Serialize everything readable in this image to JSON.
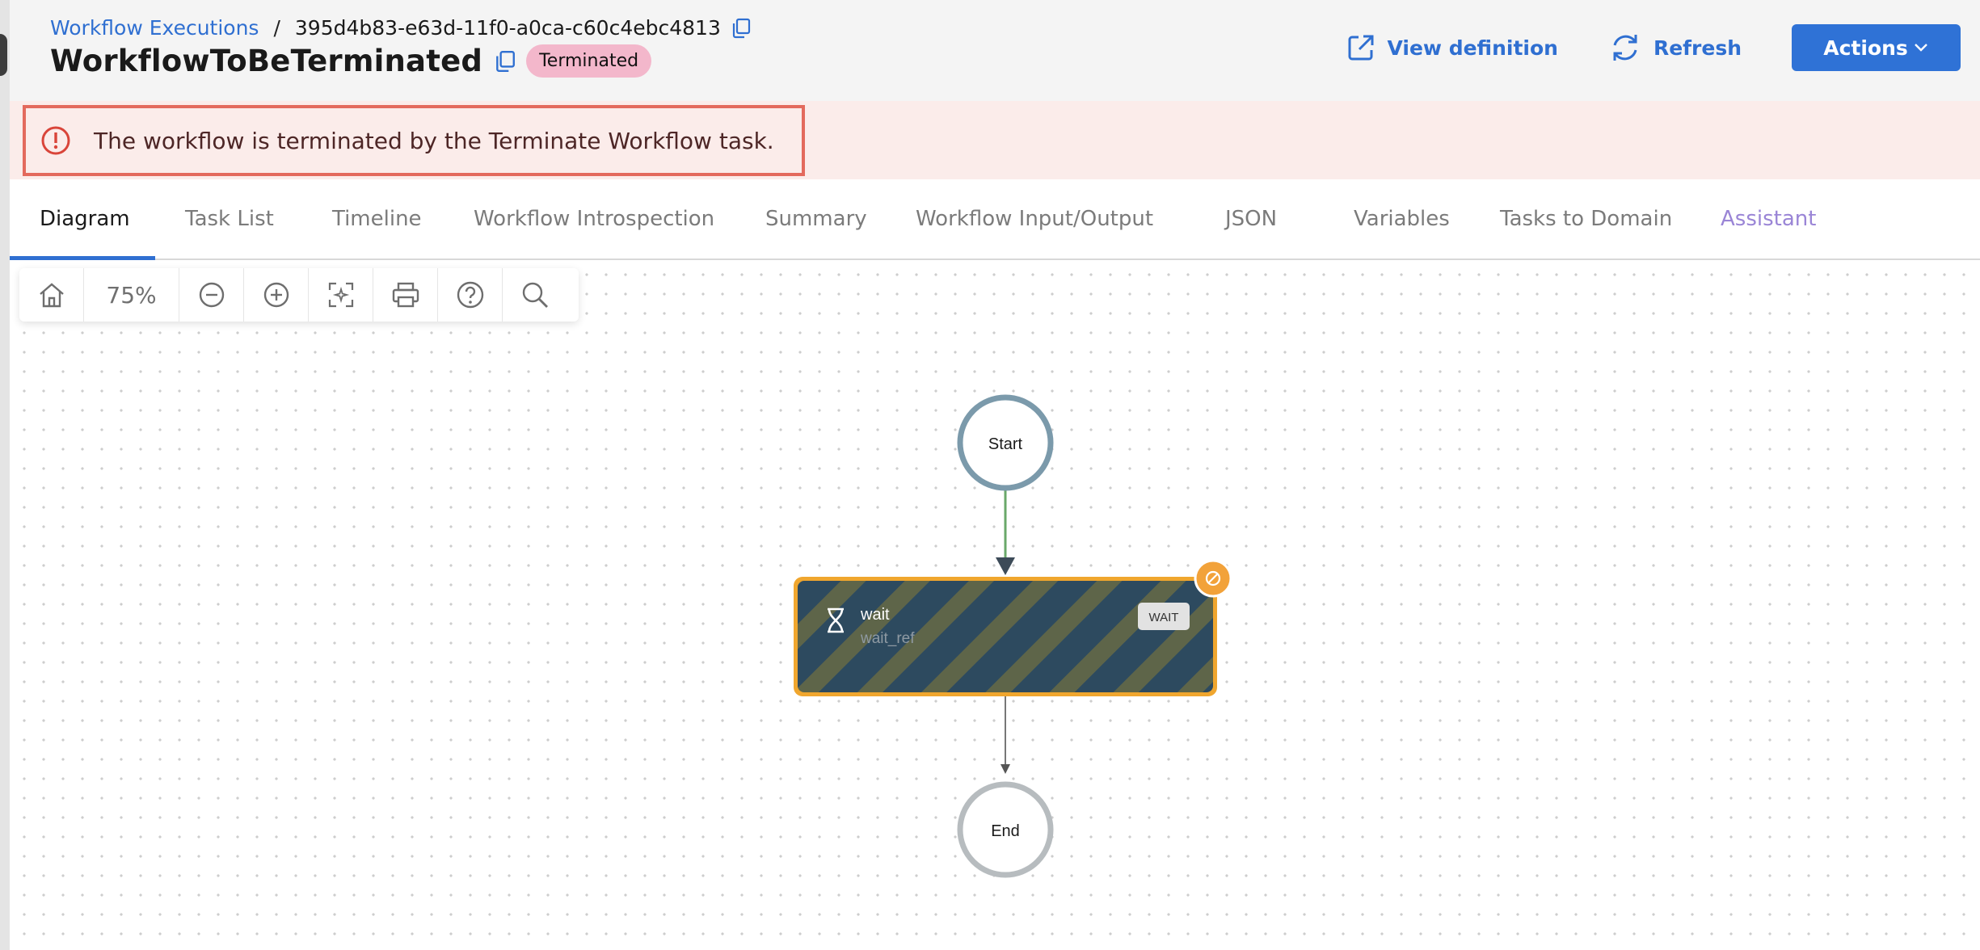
{
  "breadcrumb": {
    "parent": "Workflow Executions",
    "separator": "/",
    "execution_id": "395d4b83-e63d-11f0-a0ca-c60c4ebc4813"
  },
  "workflow": {
    "name": "WorkflowToBeTerminated",
    "status": "Terminated"
  },
  "header_actions": {
    "view_definition": "View definition",
    "refresh": "Refresh",
    "actions": "Actions"
  },
  "alert": {
    "message": "The workflow is terminated by the Terminate Workflow task."
  },
  "tabs": [
    {
      "label": "Diagram"
    },
    {
      "label": "Task List"
    },
    {
      "label": "Timeline"
    },
    {
      "label": "Workflow Introspection"
    },
    {
      "label": "Summary"
    },
    {
      "label": "Workflow Input/Output"
    },
    {
      "label": "JSON"
    },
    {
      "label": "Variables"
    },
    {
      "label": "Tasks to Domain"
    },
    {
      "label": "Assistant"
    }
  ],
  "toolbar": {
    "zoom_level": "75%"
  },
  "diagram": {
    "start_label": "Start",
    "end_label": "End",
    "task": {
      "name": "wait",
      "ref": "wait_ref",
      "type_badge": "WAIT"
    }
  },
  "colors": {
    "accent": "#2f72d6",
    "badge_terminated": "#f3b7cb",
    "alert_border": "#e36a5d",
    "alert_bg": "#fbecea",
    "task_border": "#f0a62e",
    "task_fill": "#2e4b60",
    "start_ring": "#7b9aab",
    "end_ring": "#b7bcbf",
    "edge_success": "#6aa86a"
  }
}
